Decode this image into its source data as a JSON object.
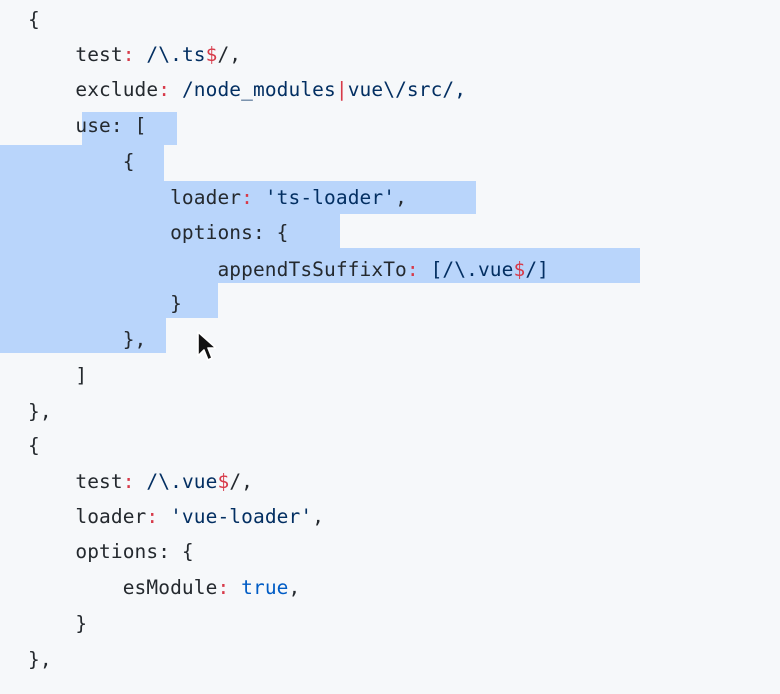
{
  "code": {
    "lines": [
      [
        {
          "t": "{",
          "k": "punct"
        }
      ],
      [
        {
          "t": "    test",
          "k": "key"
        },
        {
          "t": ": ",
          "k": "regexsym"
        },
        {
          "t": "/\\.ts",
          "k": "regex"
        },
        {
          "t": "$",
          "k": "regexsym"
        },
        {
          "t": "/,",
          "k": "punct"
        }
      ],
      [
        {
          "t": "    exclude",
          "k": "key"
        },
        {
          "t": ": ",
          "k": "regexsym"
        },
        {
          "t": "/node_modules",
          "k": "regex"
        },
        {
          "t": "|",
          "k": "regexsym"
        },
        {
          "t": "vue\\/src/,",
          "k": "regex"
        }
      ],
      [
        {
          "t": "    use",
          "k": "key"
        },
        {
          "t": ": [",
          "k": "punct"
        }
      ],
      [
        {
          "t": "        {",
          "k": "punct"
        }
      ],
      [
        {
          "t": "            loader",
          "k": "key"
        },
        {
          "t": ": ",
          "k": "regexsym"
        },
        {
          "t": "'ts-loader'",
          "k": "string"
        },
        {
          "t": ",",
          "k": "punct"
        }
      ],
      [
        {
          "t": "            options",
          "k": "key"
        },
        {
          "t": ": {",
          "k": "punct"
        }
      ],
      [
        {
          "t": "                appendTsSuffixTo",
          "k": "key"
        },
        {
          "t": ": ",
          "k": "regexsym"
        },
        {
          "t": "[/\\.vue",
          "k": "regex"
        },
        {
          "t": "$",
          "k": "regexsym"
        },
        {
          "t": "/]",
          "k": "regex"
        }
      ],
      [
        {
          "t": "            }",
          "k": "punct"
        }
      ],
      [
        {
          "t": "        },",
          "k": "punct"
        }
      ],
      [
        {
          "t": "    ]",
          "k": "punct"
        }
      ],
      [
        {
          "t": "},",
          "k": "punct"
        }
      ],
      [
        {
          "t": "{",
          "k": "punct"
        }
      ],
      [
        {
          "t": "    test",
          "k": "key"
        },
        {
          "t": ": ",
          "k": "regexsym"
        },
        {
          "t": "/\\.vue",
          "k": "regex"
        },
        {
          "t": "$",
          "k": "regexsym"
        },
        {
          "t": "/,",
          "k": "punct"
        }
      ],
      [
        {
          "t": "    loader",
          "k": "key"
        },
        {
          "t": ": ",
          "k": "regexsym"
        },
        {
          "t": "'vue-loader'",
          "k": "string"
        },
        {
          "t": ",",
          "k": "punct"
        }
      ],
      [
        {
          "t": "    options",
          "k": "key"
        },
        {
          "t": ": {",
          "k": "punct"
        }
      ],
      [
        {
          "t": "        esModule",
          "k": "key"
        },
        {
          "t": ": ",
          "k": "regexsym"
        },
        {
          "t": "true",
          "k": "bool"
        },
        {
          "t": ",",
          "k": "punct"
        }
      ],
      [
        {
          "t": "    }",
          "k": "punct"
        }
      ],
      [
        {
          "t": "},",
          "k": "punct"
        }
      ]
    ]
  },
  "icons": {
    "cursor": "arrow-pointer-icon"
  },
  "colors": {
    "background": "#f6f8fa",
    "selection": "#b9d5fb",
    "text": "#24292e",
    "regex": "#032f62",
    "symbol": "#d73a49",
    "boolean": "#005cc5"
  }
}
